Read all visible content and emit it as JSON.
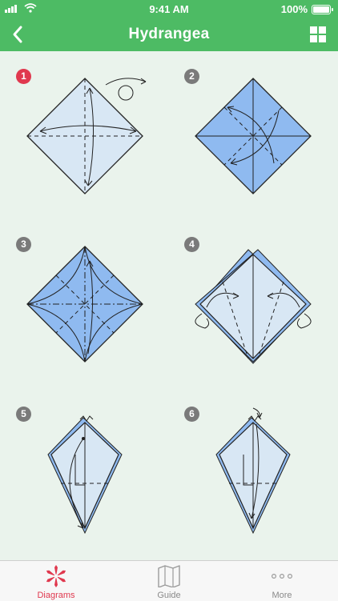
{
  "status": {
    "time": "9:41 AM",
    "battery": "100%"
  },
  "header": {
    "title": "Hydrangea"
  },
  "steps": [
    {
      "number": "1"
    },
    {
      "number": "2"
    },
    {
      "number": "3"
    },
    {
      "number": "4"
    },
    {
      "number": "5"
    },
    {
      "number": "6"
    }
  ],
  "colors": {
    "accent": "#4dbb64",
    "active_step": "#e0384e",
    "step_badge": "#7a7a7a",
    "paper_front": "#d8e7f4",
    "paper_back": "#8fbaf0"
  },
  "tabs": [
    {
      "label": "Diagrams",
      "icon": "flower-icon",
      "active": true
    },
    {
      "label": "Guide",
      "icon": "map-icon",
      "active": false
    },
    {
      "label": "More",
      "icon": "more-dots-icon",
      "active": false
    }
  ]
}
